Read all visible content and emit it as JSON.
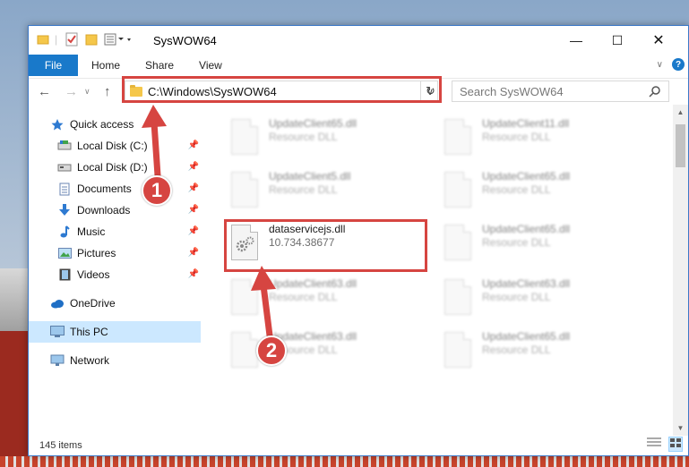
{
  "window": {
    "title": "SysWOW64"
  },
  "ribbon": {
    "tabs": [
      "File",
      "Home",
      "Share",
      "View"
    ],
    "help": "?"
  },
  "address_bar": {
    "path": "C:\\Windows\\SysWOW64"
  },
  "search": {
    "placeholder": "Search SysWOW64"
  },
  "sidebar": {
    "items": [
      {
        "label": "Quick access",
        "icon": "star-icon"
      },
      {
        "label": "Local Disk (C:)",
        "icon": "drive-icon",
        "pinned": true
      },
      {
        "label": "Local Disk (D:)",
        "icon": "drive-icon",
        "pinned": true
      },
      {
        "label": "Documents",
        "icon": "documents-icon",
        "pinned": true
      },
      {
        "label": "Downloads",
        "icon": "download-icon",
        "pinned": true
      },
      {
        "label": "Music",
        "icon": "music-icon",
        "pinned": true
      },
      {
        "label": "Pictures",
        "icon": "pictures-icon",
        "pinned": true
      },
      {
        "label": "Videos",
        "icon": "videos-icon",
        "pinned": true
      },
      {
        "label": "OneDrive",
        "icon": "cloud-icon"
      },
      {
        "label": "This PC",
        "icon": "computer-icon",
        "selected": true
      },
      {
        "label": "Network",
        "icon": "network-icon"
      }
    ]
  },
  "files": [
    {
      "name": "UpdateClient65.dll",
      "type": "Resource DLL",
      "blurred": true
    },
    {
      "name": "UpdateClient11.dll",
      "type": "Resource DLL",
      "blurred": true
    },
    {
      "name": "UpdateClient5.dll",
      "type": "Resource DLL",
      "blurred": true
    },
    {
      "name": "UpdateClient65.dll",
      "type": "Resource DLL",
      "blurred": true
    },
    {
      "name": "dataservicejs.dll",
      "type": "10.734.38677",
      "blurred": false
    },
    {
      "name": "UpdateClient65.dll",
      "type": "Resource DLL",
      "blurred": true
    },
    {
      "name": "UpdateClient63.dll",
      "type": "Resource DLL",
      "blurred": true
    },
    {
      "name": "UpdateClient63.dll",
      "type": "Resource DLL",
      "blurred": true
    },
    {
      "name": "UpdateClient63.dll",
      "type": "Resource DLL",
      "blurred": true
    },
    {
      "name": "UpdateClient65.dll",
      "type": "Resource DLL",
      "blurred": true
    }
  ],
  "status": {
    "item_count": "145 items"
  },
  "callouts": {
    "one": "1",
    "two": "2"
  },
  "colors": {
    "accent": "#1979ca",
    "highlight": "#d64541",
    "selected": "#cce8ff"
  }
}
